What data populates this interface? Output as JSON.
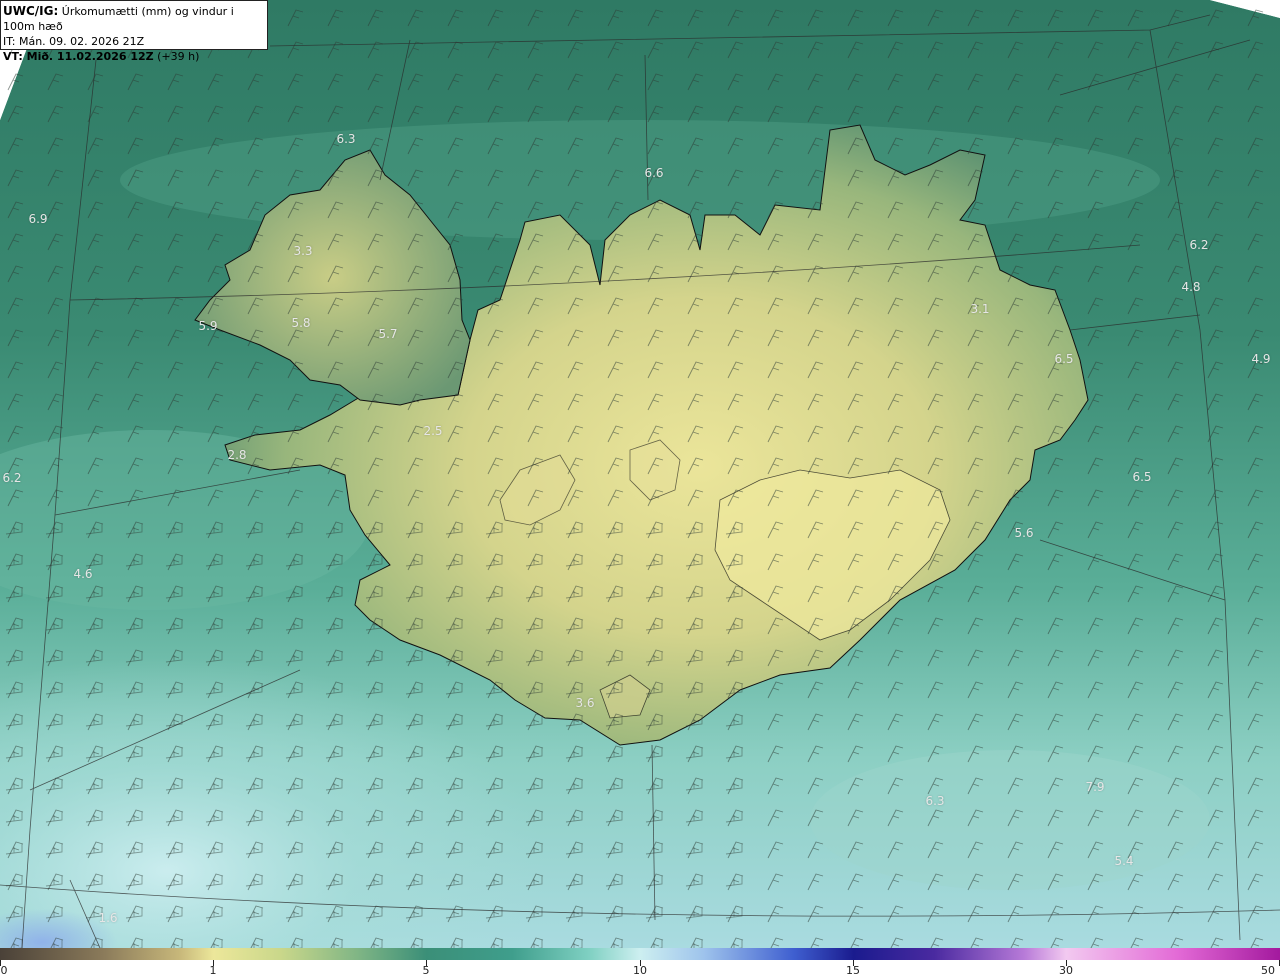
{
  "header": {
    "model": "UWC/IG:",
    "title": "Úrkomumætti (mm) og vindur i 100m hæð",
    "it_line": "IT: Mán. 09. 02. 2026 21Z",
    "vt_label": "VT: Mið. 11.02.2026 12Z",
    "vt_suffix": "(+39 h)"
  },
  "map_labels": [
    {
      "text": "6.3"
    },
    {
      "text": "6.6"
    },
    {
      "text": "6.9"
    },
    {
      "text": "3.3"
    },
    {
      "text": "6.2"
    },
    {
      "text": "4.8"
    },
    {
      "text": "3.1"
    },
    {
      "text": "5.9"
    },
    {
      "text": "5.8"
    },
    {
      "text": "5.7"
    },
    {
      "text": "6.5"
    },
    {
      "text": "4.9"
    },
    {
      "text": "2.5"
    },
    {
      "text": "2.8"
    },
    {
      "text": "6.2"
    },
    {
      "text": "6.5"
    },
    {
      "text": "5.6"
    },
    {
      "text": "4.6"
    },
    {
      "text": "3.6"
    },
    {
      "text": "7.9"
    },
    {
      "text": "6.3"
    },
    {
      "text": "5.4"
    },
    {
      "text": "1.6"
    }
  ],
  "colorbar": {
    "ticks": [
      "0",
      "1",
      "5",
      "10",
      "15",
      "30",
      "50"
    ]
  },
  "colors": {
    "ocean_dark": "#2f7f6a",
    "ocean_mid": "#4ea08a",
    "ocean_light": "#bfe6e4",
    "land_low": "#7fa46e",
    "land_high": "#e3df93",
    "label": "#e6e6e6"
  }
}
